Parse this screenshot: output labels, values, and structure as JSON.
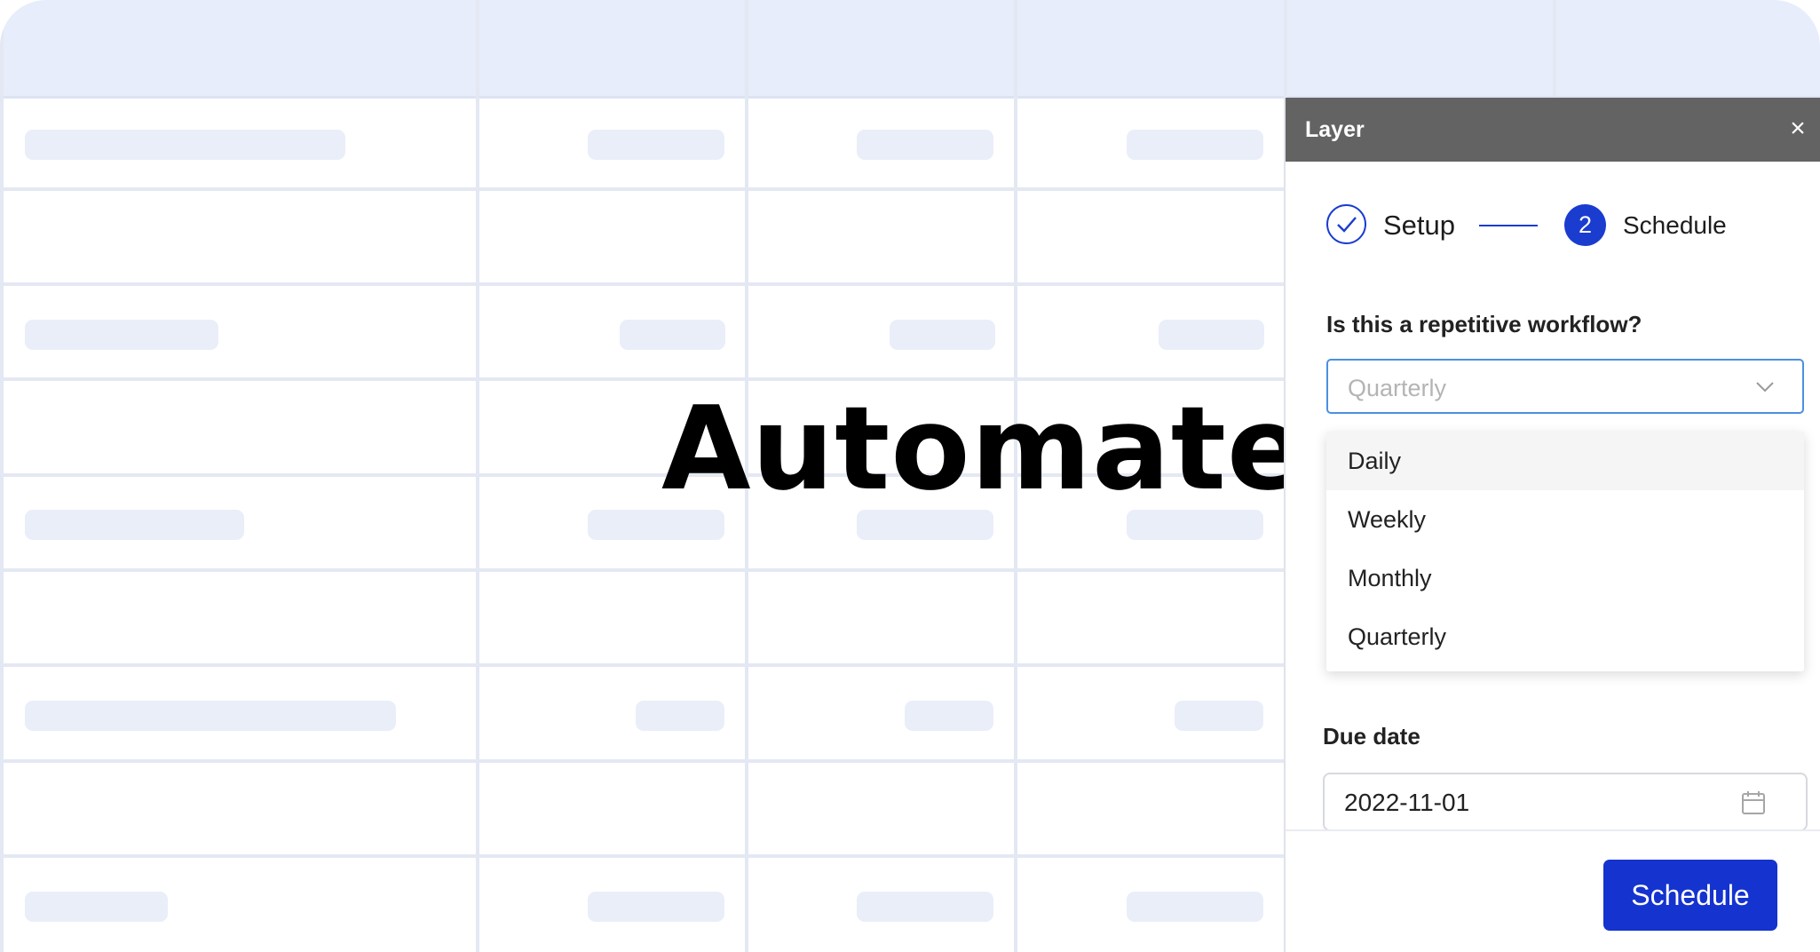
{
  "overlay": {
    "headline": "Automate"
  },
  "panel": {
    "title": "Layer",
    "close_icon": "×",
    "steps": [
      {
        "label": "Setup",
        "state": "done",
        "icon": "check-icon"
      },
      {
        "number": "2",
        "label": "Schedule",
        "state": "active"
      }
    ],
    "repetition": {
      "label": "Is this a repetitive workflow?",
      "placeholder": "Quarterly",
      "options": [
        "Daily",
        "Weekly",
        "Monthly",
        "Quarterly"
      ],
      "highlighted_option": "Daily"
    },
    "due_date": {
      "label": "Due date",
      "value": "2022-11-01",
      "icon": "calendar-icon"
    },
    "submit_label": "Schedule"
  },
  "colors": {
    "accent": "#1533cf",
    "header_bg": "#636363",
    "table_header_bg": "#e8edfc",
    "skeleton": "#e9eef9"
  }
}
